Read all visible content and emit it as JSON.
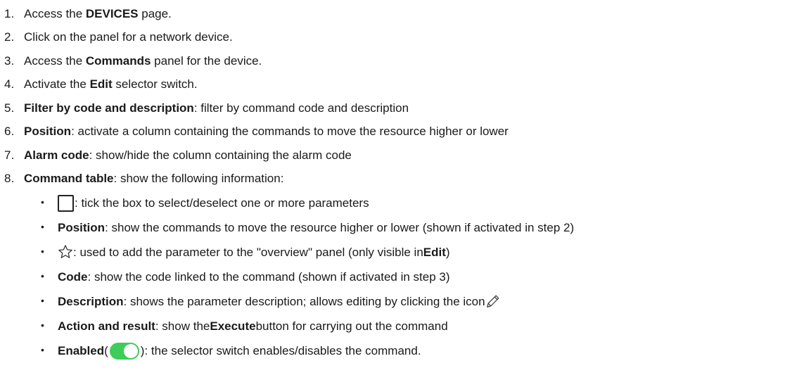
{
  "steps": [
    {
      "num": "1.",
      "pre": "Access the ",
      "bold": "DEVICES",
      "post": " page."
    },
    {
      "num": "2.",
      "pre": "Click on the panel for a network device.",
      "bold": "",
      "post": ""
    },
    {
      "num": "3.",
      "pre": "Access the ",
      "bold": "Commands",
      "post": " panel for the device."
    },
    {
      "num": "4.",
      "pre": "Activate the ",
      "bold": "Edit",
      "post": " selector switch."
    },
    {
      "num": "5.",
      "pre": "",
      "bold": "Filter by code and description",
      "post": ": filter by command code and description"
    },
    {
      "num": "6.",
      "pre": "",
      "bold": "Position",
      "post": ": activate a column containing the commands to move the resource higher or lower"
    },
    {
      "num": "7.",
      "pre": "",
      "bold": "Alarm code",
      "post": ": show/hide the column containing the alarm code"
    },
    {
      "num": "8.",
      "pre": "",
      "bold": "Command table",
      "post": ": show the following information:"
    }
  ],
  "table_items": {
    "checkbox": {
      "text": ": tick the box to select/deselect one or more parameters",
      "icon": "checkbox-icon"
    },
    "position": {
      "bold": "Position",
      "text": ": show the commands to move the resource higher or lower (shown if activated in step 2)"
    },
    "star": {
      "text_a": ": used to add the parameter to the \"overview\" panel (only visible in ",
      "bold": "Edit",
      "text_b": ")",
      "icon": "star-icon"
    },
    "code": {
      "bold": "Code",
      "text": ": show the code linked to the command (shown if activated in step 3)"
    },
    "description": {
      "bold": "Description",
      "text": ": shows the parameter description; allows editing by clicking the icon",
      "icon": "pencil-icon"
    },
    "action": {
      "bold": "Action and result",
      "text_a": ": show the ",
      "bold2": "Execute",
      "text_b": " button for carrying out the command"
    },
    "enabled": {
      "bold": "Enabled",
      "text_a": " (",
      "text_b": "): the selector switch enables/disables the command.",
      "icon": "toggle-switch-icon",
      "color": "#3dcd58"
    }
  },
  "bullets": {
    "dot": "•"
  }
}
